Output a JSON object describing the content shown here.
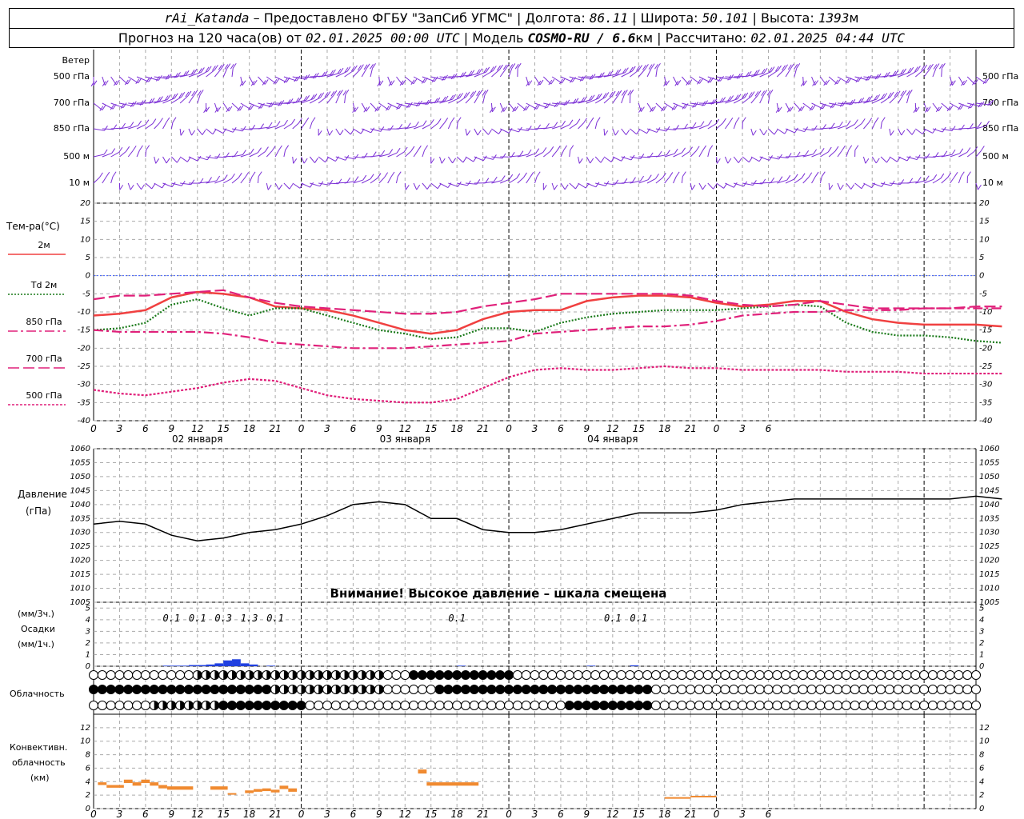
{
  "header": {
    "station": "rAi_Katanda",
    "provider": "Предоставлено ФГБУ \"ЗапСиб УГМС\"",
    "lon_label": "Долгота:",
    "lon": "86.11",
    "lat_label": "Широта:",
    "lat": "50.101",
    "alt_label": "Высота:",
    "alt": "1393",
    "alt_unit": "м",
    "forecast_label": "Прогноз на 120 часа(ов) от",
    "forecast_start": "02.01.2025 00:00 UTC",
    "model_label": "Модель",
    "model": "COSMO-RU / 6.6",
    "model_unit": "км",
    "computed_label": "Рассчитано:",
    "computed": "02.01.2025 04:44 UTC"
  },
  "wind_panel": {
    "title": "Ветер",
    "levels": [
      "500 гПа",
      "700 гПа",
      "850 гПа",
      "500 м",
      "10 м"
    ],
    "color": "#7b2fd6"
  },
  "temp_panel": {
    "title": "Тем-ра(°C)",
    "legend": [
      {
        "label": "2м",
        "color": "#f04040",
        "dash": "solid"
      },
      {
        "label": "Td  2м",
        "color": "#1a7a1a",
        "dash": "dotted"
      },
      {
        "label": "850 гПа",
        "color": "#e0207a",
        "dash": "dashdot"
      },
      {
        "label": "700 гПа",
        "color": "#e0207a",
        "dash": "longdash"
      },
      {
        "label": "500 гПа",
        "color": "#e0207a",
        "dash": "dot"
      }
    ]
  },
  "time_axis": {
    "tick_labels": [
      "0",
      "3",
      "6",
      "9",
      "12",
      "15",
      "18",
      "21",
      "0",
      "3",
      "6",
      "9",
      "12",
      "15",
      "18",
      "21",
      "0",
      "3",
      "6",
      "9",
      "12",
      "15",
      "18",
      "21",
      "0",
      "3",
      "6"
    ],
    "date_labels": [
      "02 января",
      "03 января",
      "04 января"
    ]
  },
  "pressure_panel": {
    "title_line1": "Давление",
    "title_line2": "(гПа)",
    "warning": "Внимание! Высокое давление – шкала смещена"
  },
  "precip_panel": {
    "title_line1": "(мм/3ч.)",
    "title_line2": "Осадки",
    "title_line3": "(мм/1ч.)",
    "labels": [
      {
        "hour": 9,
        "text": "0.1"
      },
      {
        "hour": 12,
        "text": "0.1"
      },
      {
        "hour": 15,
        "text": "0.3"
      },
      {
        "hour": 18,
        "text": "1.3"
      },
      {
        "hour": 21,
        "text": "0.1"
      },
      {
        "hour": 42,
        "text": "0.1"
      },
      {
        "hour": 60,
        "text": "0.1"
      },
      {
        "hour": 63,
        "text": "0.1"
      }
    ],
    "color": "#2040e0"
  },
  "cloud_panel": {
    "title": "Облачность"
  },
  "convective_panel": {
    "title_line1": "Конвективн.",
    "title_line2": "облачность",
    "title_line3": "(км)",
    "color": "#f08a30"
  },
  "chart_data": [
    {
      "type": "line",
      "title": "Тем-ра(°C)",
      "ylim": [
        -40,
        20
      ],
      "yticks": [
        20,
        15,
        10,
        5,
        0,
        -5,
        -10,
        -15,
        -20,
        -25,
        -30,
        -35,
        -40
      ],
      "x_hours": [
        0,
        3,
        6,
        9,
        12,
        15,
        18,
        21,
        24,
        27,
        30,
        33,
        36,
        39,
        42,
        45,
        48,
        51,
        54,
        57,
        60,
        63,
        66,
        69,
        72,
        75,
        78,
        81,
        84,
        87,
        90,
        93,
        96,
        99,
        102,
        105
      ],
      "series": [
        {
          "name": "2м",
          "values": [
            -11,
            -10.5,
            -9.5,
            -6,
            -4.5,
            -5,
            -6,
            -8.5,
            -9,
            -9.5,
            -11,
            -13,
            -15,
            -16,
            -15,
            -12,
            -10,
            -9.5,
            -9.5,
            -7,
            -6,
            -5.5,
            -5.5,
            -6,
            -7.5,
            -8.5,
            -8,
            -7,
            -7,
            -10,
            -12,
            -13,
            -13.5,
            -13.5,
            -13.5,
            -14
          ]
        },
        {
          "name": "Td  2м",
          "values": [
            -15,
            -14.5,
            -13,
            -8,
            -6.5,
            -9,
            -11,
            -9,
            -9,
            -11,
            -13,
            -15,
            -16,
            -17.5,
            -17,
            -14.5,
            -14.5,
            -15.5,
            -13,
            -11.5,
            -10.5,
            -10,
            -9.5,
            -9.5,
            -9.5,
            -9,
            -8.5,
            -8,
            -8.5,
            -13,
            -15.5,
            -16.5,
            -16.5,
            -17,
            -18,
            -18.5
          ]
        },
        {
          "name": "850 гПа",
          "values": [
            -15,
            -15.5,
            -15.5,
            -15.5,
            -15.5,
            -16,
            -17,
            -18.5,
            -19,
            -19.5,
            -20,
            -20,
            -20,
            -19.5,
            -19,
            -18.5,
            -18,
            -16,
            -15.5,
            -15,
            -14.5,
            -14,
            -14,
            -13.5,
            -12.5,
            -11,
            -10.5,
            -10,
            -10,
            -9.5,
            -9.5,
            -9.5,
            -9,
            -9,
            -9,
            -9
          ]
        },
        {
          "name": "700 гПа",
          "values": [
            -6.5,
            -5.5,
            -5.5,
            -5,
            -4.5,
            -4,
            -6,
            -7.5,
            -8.5,
            -9,
            -9.5,
            -10,
            -10.5,
            -10.5,
            -10,
            -8.5,
            -7.5,
            -6.5,
            -5,
            -5,
            -5,
            -5,
            -5,
            -5.5,
            -7,
            -8,
            -8.5,
            -8,
            -7,
            -8,
            -9,
            -9,
            -9,
            -9,
            -8.5,
            -8.5
          ]
        },
        {
          "name": "500 гПа",
          "values": [
            -31.5,
            -32.5,
            -33,
            -32,
            -31,
            -29.5,
            -28.5,
            -29,
            -31,
            -33,
            -34,
            -34.5,
            -35,
            -35,
            -34,
            -31,
            -28,
            -26,
            -25.5,
            -26,
            -26,
            -25.5,
            -25,
            -25.5,
            -25.5,
            -26,
            -26,
            -26,
            -26,
            -26.5,
            -26.5,
            -26.5,
            -27,
            -27,
            -27,
            -27
          ]
        }
      ]
    },
    {
      "type": "line",
      "title": "Давление (гПа)",
      "ylim": [
        1005,
        1060
      ],
      "yticks": [
        1060,
        1055,
        1050,
        1045,
        1040,
        1035,
        1030,
        1025,
        1020,
        1015,
        1010,
        1005
      ],
      "x_hours": [
        0,
        3,
        6,
        9,
        12,
        15,
        18,
        21,
        24,
        27,
        30,
        33,
        36,
        39,
        42,
        45,
        48,
        51,
        54,
        57,
        60,
        63,
        66,
        69,
        72,
        75,
        78,
        81,
        84,
        87,
        90,
        93,
        96,
        99,
        102,
        105
      ],
      "series": [
        {
          "name": "",
          "values": [
            1033,
            1034,
            1033,
            1029,
            1027,
            1028,
            1030,
            1031,
            1033,
            1036,
            1040,
            1041,
            1040,
            1035,
            1035,
            1031,
            1030,
            1030,
            1031,
            1033,
            1035,
            1037,
            1037,
            1037,
            1038,
            1040,
            1041,
            1042,
            1042,
            1042,
            1042,
            1042,
            1042,
            1042,
            1043,
            1042
          ]
        }
      ]
    },
    {
      "type": "bar",
      "title": "Осадки",
      "ylim": [
        0,
        5
      ],
      "yticks": [
        5,
        4,
        3,
        2,
        1,
        0
      ],
      "bars_mm_per_1h": [
        {
          "hour": 8.5,
          "value": 0.05
        },
        {
          "hour": 9.5,
          "value": 0.05
        },
        {
          "hour": 10.5,
          "value": 0.05
        },
        {
          "hour": 11.5,
          "value": 0.1
        },
        {
          "hour": 12.5,
          "value": 0.1
        },
        {
          "hour": 13.5,
          "value": 0.15
        },
        {
          "hour": 14.5,
          "value": 0.25
        },
        {
          "hour": 15.5,
          "value": 0.5
        },
        {
          "hour": 16.5,
          "value": 0.6
        },
        {
          "hour": 17.5,
          "value": 0.25
        },
        {
          "hour": 18.5,
          "value": 0.15
        },
        {
          "hour": 20.5,
          "value": 0.05
        },
        {
          "hour": 42.5,
          "value": 0.05
        },
        {
          "hour": 57.5,
          "value": 0.05
        },
        {
          "hour": 62.5,
          "value": 0.08
        }
      ]
    },
    {
      "type": "bar",
      "title": "Конвективн. облачность (км)",
      "ylim": [
        0,
        13
      ],
      "yticks": [
        12,
        10,
        8,
        6,
        4,
        2,
        0
      ],
      "segments_km": [
        {
          "h0": 0.5,
          "h1": 1.5,
          "top": 3.9,
          "bottom": 3.5
        },
        {
          "h0": 1.5,
          "h1": 3.5,
          "top": 3.5,
          "bottom": 3.1
        },
        {
          "h0": 3.5,
          "h1": 4.5,
          "top": 4.3,
          "bottom": 3.8
        },
        {
          "h0": 4.5,
          "h1": 5.5,
          "top": 3.9,
          "bottom": 3.4
        },
        {
          "h0": 5.5,
          "h1": 6.5,
          "top": 4.3,
          "bottom": 3.8
        },
        {
          "h0": 6.5,
          "h1": 7.5,
          "top": 3.9,
          "bottom": 3.4
        },
        {
          "h0": 7.5,
          "h1": 8.5,
          "top": 3.5,
          "bottom": 3.0
        },
        {
          "h0": 8.5,
          "h1": 11.5,
          "top": 3.3,
          "bottom": 2.8
        },
        {
          "h0": 13.5,
          "h1": 15.5,
          "top": 3.3,
          "bottom": 2.8
        },
        {
          "h0": 15.5,
          "h1": 16.5,
          "top": 2.3,
          "bottom": 2.1
        },
        {
          "h0": 17.5,
          "h1": 18.5,
          "top": 2.7,
          "bottom": 2.3
        },
        {
          "h0": 18.5,
          "h1": 19.5,
          "top": 2.9,
          "bottom": 2.5
        },
        {
          "h0": 19.5,
          "h1": 20.5,
          "top": 3.0,
          "bottom": 2.6
        },
        {
          "h0": 20.5,
          "h1": 21.5,
          "top": 2.8,
          "bottom": 2.4
        },
        {
          "h0": 21.5,
          "h1": 22.5,
          "top": 3.4,
          "bottom": 2.9
        },
        {
          "h0": 22.5,
          "h1": 23.5,
          "top": 3.0,
          "bottom": 2.5
        },
        {
          "h0": 37.5,
          "h1": 38.5,
          "top": 5.8,
          "bottom": 5.2
        },
        {
          "h0": 38.5,
          "h1": 44.5,
          "top": 3.9,
          "bottom": 3.4
        },
        {
          "h0": 66,
          "h1": 69,
          "top": 1.7,
          "bottom": 1.5
        },
        {
          "h0": 69,
          "h1": 72,
          "top": 1.9,
          "bottom": 1.7
        }
      ]
    }
  ]
}
